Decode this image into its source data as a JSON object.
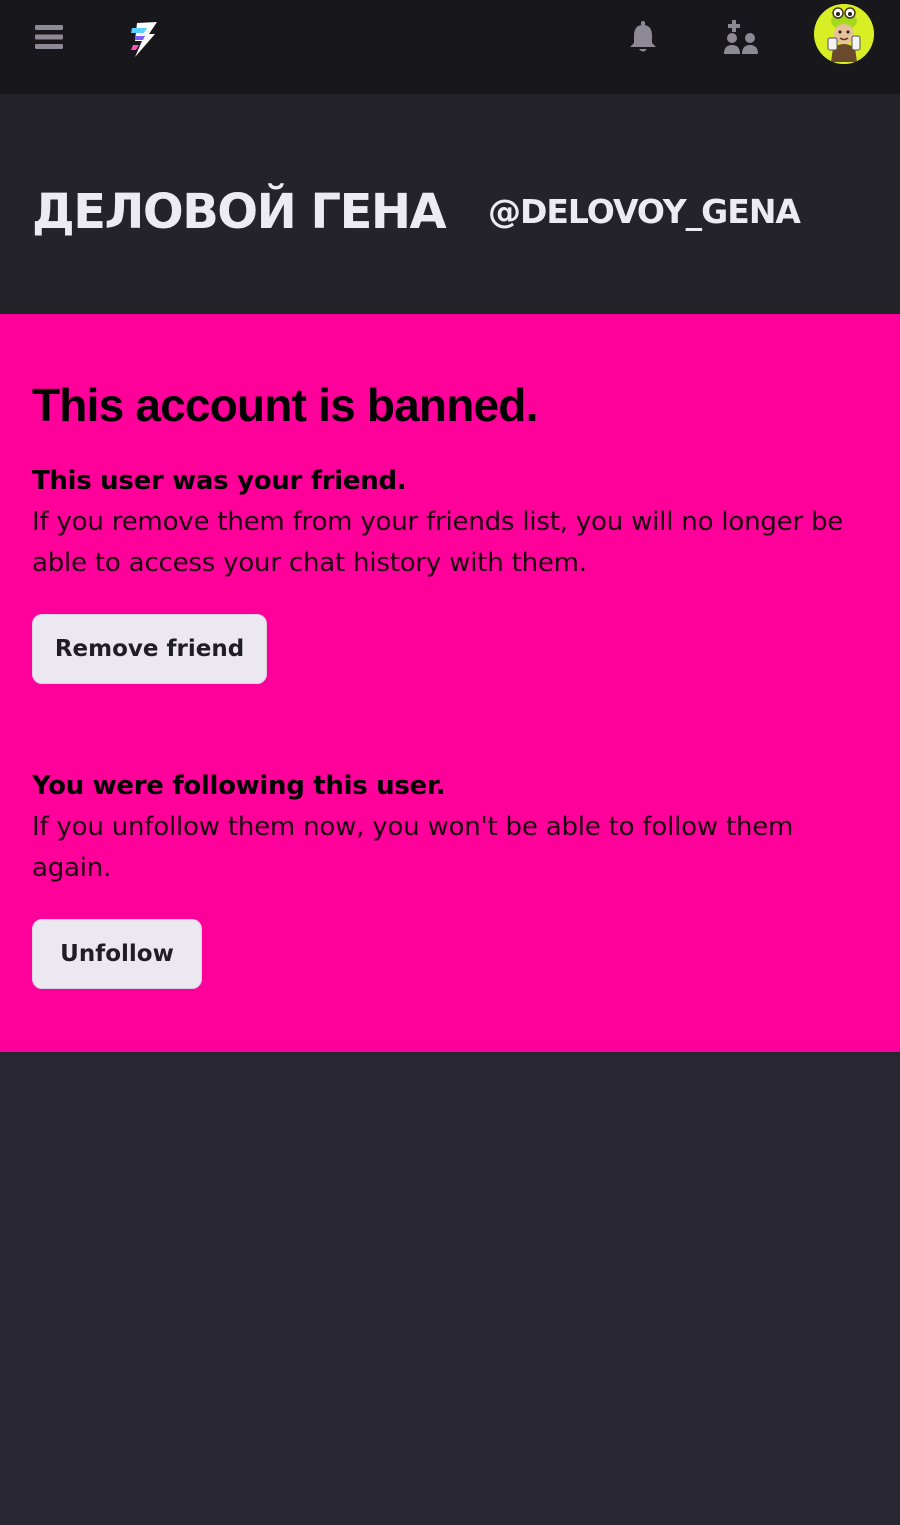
{
  "topbar": {
    "icons": {
      "menu": "hamburger-menu-icon",
      "logo": "lightning-bolt-logo",
      "notifications": "bell-icon",
      "friends": "add-friend-icon",
      "avatar": "user-avatar"
    },
    "avatar_color": "#d9ef25"
  },
  "profile": {
    "display_name": "ДЕЛОВОЙ ГЕНА",
    "handle": "@DELOVOY_GENA"
  },
  "ban_notice": {
    "title": "This account is banned.",
    "background_color": "#ff009b",
    "friend_section": {
      "heading": "This user was your friend.",
      "text": "If you remove them from your friends list, you will no longer be able to access your chat history with them.",
      "button_label": "Remove friend"
    },
    "follow_section": {
      "heading": "You were following this user.",
      "text": "If you unfollow them now, you won't be able to follow them again.",
      "button_label": "Unfollow"
    }
  }
}
